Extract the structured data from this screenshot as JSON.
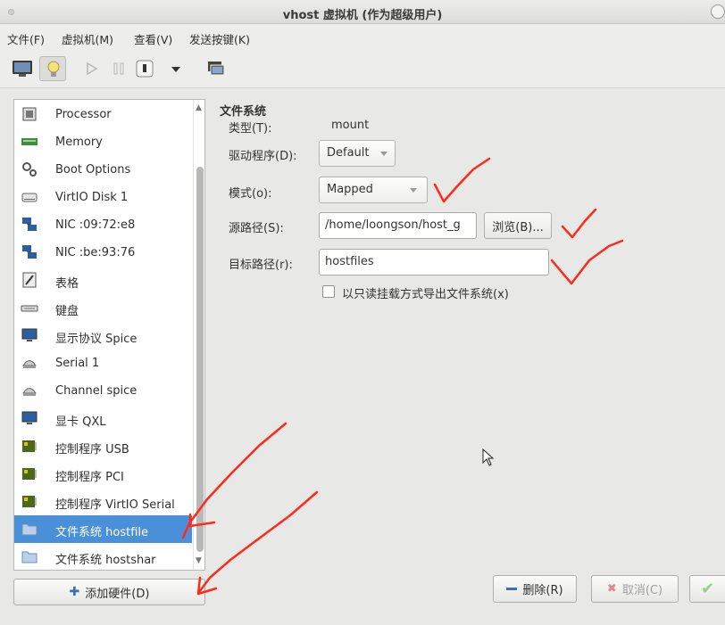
{
  "window": {
    "title": "vhost 虚拟机 (作为超级用户)"
  },
  "menubar": {
    "items": [
      {
        "label": "文件(F)"
      },
      {
        "label": "虚拟机(M)"
      },
      {
        "label": "查看(V)"
      },
      {
        "label": "发送按键(K)"
      }
    ]
  },
  "toolbar": {
    "icons": [
      "monitor-icon",
      "lightbulb-icon",
      "play-icon",
      "pause-icon",
      "power-icon",
      "dropdown-arrow-icon",
      "snapshot-icon"
    ]
  },
  "hardware_list": {
    "items": [
      {
        "label": "Processor",
        "icon": "processor-icon"
      },
      {
        "label": "Memory",
        "icon": "memory-icon"
      },
      {
        "label": "Boot Options",
        "icon": "boot-options-icon"
      },
      {
        "label": "VirtIO Disk 1",
        "icon": "disk-icon"
      },
      {
        "label": "NIC :09:72:e8",
        "icon": "nic-icon"
      },
      {
        "label": "NIC :be:93:76",
        "icon": "nic-icon"
      },
      {
        "label": "表格",
        "icon": "tablet-icon"
      },
      {
        "label": "键盘",
        "icon": "keyboard-icon"
      },
      {
        "label": "显示协议 Spice",
        "icon": "display-icon"
      },
      {
        "label": "Serial 1",
        "icon": "serial-icon"
      },
      {
        "label": "Channel spice",
        "icon": "channel-icon"
      },
      {
        "label": "显卡 QXL",
        "icon": "video-icon"
      },
      {
        "label": "控制程序 USB",
        "icon": "controller-icon"
      },
      {
        "label": "控制程序 PCI",
        "icon": "controller-icon"
      },
      {
        "label": "控制程序 VirtIO Serial",
        "icon": "controller-icon"
      },
      {
        "label": "文件系统 hostfile",
        "icon": "folder-icon",
        "selected": true
      },
      {
        "label": "文件系统 hostshar",
        "icon": "folder-icon"
      }
    ],
    "add_button": "添加硬件(D)"
  },
  "details": {
    "section_title": "文件系统",
    "type_label": "类型(T):",
    "type_value": "mount",
    "driver_label": "驱动程序(D):",
    "driver_value": "Default",
    "mode_label": "模式(o):",
    "mode_value": "Mapped",
    "source_label": "源路径(S):",
    "source_value": "/home/loongson/host_g",
    "browse_button": "浏览(B)...",
    "target_label": "目标路径(r):",
    "target_value": "hostfiles",
    "readonly_label": "以只读挂载方式导出文件系统(x)",
    "readonly_checked": false
  },
  "footer": {
    "delete_button": "删除(R)",
    "cancel_button": "取消(C)"
  },
  "colors": {
    "selection": "#4a90d9",
    "annotation": "#ff2a1a"
  }
}
